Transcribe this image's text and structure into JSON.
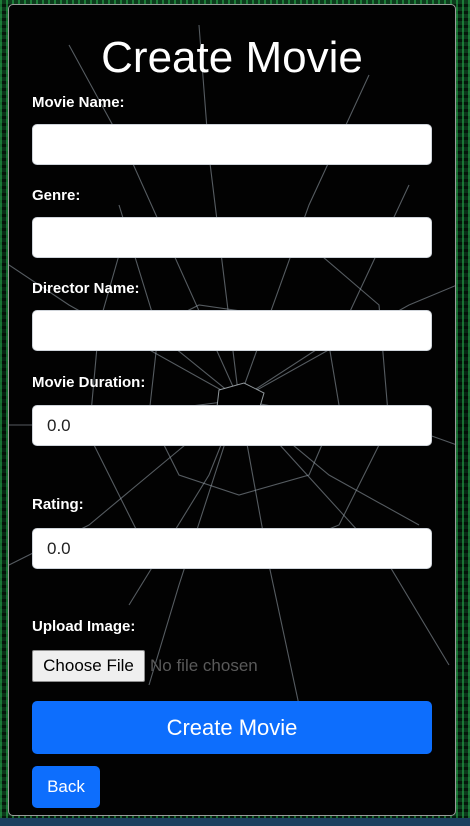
{
  "page": {
    "title": "Create Movie"
  },
  "form": {
    "movie_name": {
      "label": "Movie Name:",
      "value": ""
    },
    "genre": {
      "label": "Genre:",
      "value": ""
    },
    "director_name": {
      "label": "Director Name:",
      "value": ""
    },
    "movie_duration": {
      "label": "Movie Duration:",
      "value": "0.0"
    },
    "rating": {
      "label": "Rating:",
      "value": "0.0"
    },
    "upload_image": {
      "label": "Upload Image:",
      "button_label": "Choose File",
      "status": "No file chosen"
    },
    "submit_label": "Create Movie",
    "back_label": "Back"
  },
  "colors": {
    "primary": "#0d6efd",
    "card_background": "#020202",
    "background_accent": "#28b450"
  }
}
